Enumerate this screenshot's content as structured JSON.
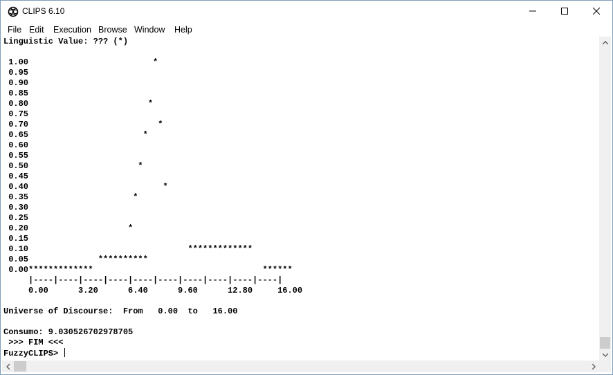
{
  "window": {
    "title": "CLIPS 6.10"
  },
  "menu": {
    "items": [
      "File",
      "Edit",
      "Execution",
      "Browse",
      "Window",
      "Help"
    ]
  },
  "console": {
    "lines": [
      "Linguistic Value: ??? (*)",
      "",
      " 1.00                         *",
      " 0.95",
      " 0.90",
      " 0.85",
      " 0.80                        *",
      " 0.75",
      " 0.70                          *",
      " 0.65                       *",
      " 0.60",
      " 0.55",
      " 0.50                      *",
      " 0.45",
      " 0.40                           *",
      " 0.35                     *",
      " 0.30",
      " 0.25",
      " 0.20                    *",
      " 0.15",
      " 0.10                                ************* ",
      " 0.05              **********",
      " 0.00*************                                  ******",
      "     |----|----|----|----|----|----|----|----|----|----|",
      "     0.00      3.20      6.40      9.60      12.80     16.00",
      "",
      "Universe of Discourse:  From   0.00  to   16.00",
      "",
      "Consumo: 9.030526702978705",
      " >>> FIM <<<",
      "FuzzyCLIPS> "
    ]
  }
}
